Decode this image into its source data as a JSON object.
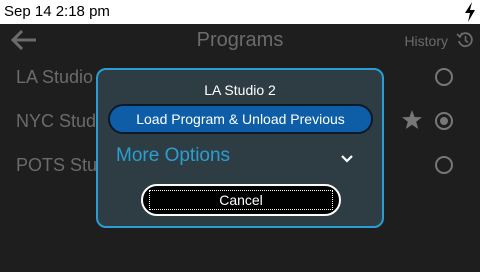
{
  "status": {
    "time": "Sep 14 2:18 pm",
    "charging_icon": "lightning-bolt-icon"
  },
  "header": {
    "title": "Programs",
    "history_label": "History",
    "back_icon": "back-arrow-icon",
    "history_icon": "history-icon"
  },
  "programs": [
    {
      "label": "LA Studio 2",
      "selected": false,
      "favorite": false
    },
    {
      "label": "NYC Studio",
      "selected": true,
      "favorite": true
    },
    {
      "label": "POTS Studio",
      "selected": false,
      "favorite": false
    }
  ],
  "dialog": {
    "title": "LA Studio 2",
    "primary_label": "Load Program & Unload Previous",
    "more_label": "More Options",
    "cancel_label": "Cancel"
  },
  "colors": {
    "accent": "#2a9ed2",
    "primary_button": "#0d5ea6",
    "dialog_bg": "#2e3d44",
    "screen_bg": "#1e1e1e"
  }
}
